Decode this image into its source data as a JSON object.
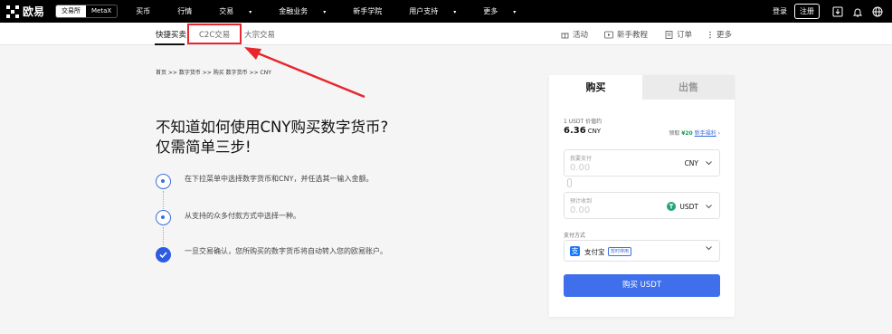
{
  "topbar": {
    "brand": "欧易",
    "segments": [
      "交易所",
      "MetaX"
    ],
    "nav": [
      "买币",
      "行情",
      "交易",
      "金融业务",
      "新手学院",
      "用户支持",
      "更多"
    ],
    "nav_dropdown": [
      false,
      false,
      true,
      true,
      false,
      true,
      true
    ],
    "login": "登录",
    "register": "注册"
  },
  "subnav": {
    "tabs": [
      "快捷买卖",
      "C2C交易",
      "大宗交易"
    ],
    "right": [
      "活动",
      "新手教程",
      "订单",
      "更多"
    ]
  },
  "breadcrumb": "首页 >> 数字货币 >> 购买 数字货币 >> CNY",
  "headline": {
    "line1": "不知道如何使用CNY购买数字货币?",
    "line2": "仅需简单三步!"
  },
  "steps": [
    "在下拉菜单中选择数字货币和CNY，并任选其一输入金额。",
    "从支持的众多付款方式中选择一种。",
    "一旦交易确认，您所购买的数字货币将自动转入您的欧易账户。"
  ],
  "card": {
    "tab_buy": "购买",
    "tab_sell": "出售",
    "price_label": "1 USDT 价值约",
    "price_value": "6.36",
    "price_unit": "CNY",
    "promo_prefix": "领取",
    "promo_amount": "¥20",
    "promo_link": "新手福利",
    "pay_field": {
      "label": "我要支付",
      "value": "0.00",
      "currency": "CNY"
    },
    "receive_field": {
      "label": "预计收到",
      "value": "0.00",
      "currency": "USDT"
    },
    "payment_label": "支付方式",
    "payment_method": "支付宝",
    "payment_tag": "暂时停用",
    "buy_button": "购买 USDT"
  },
  "colors": {
    "accent": "#3f6fea",
    "highlight": "#e8262d",
    "tether": "#26a17b"
  }
}
